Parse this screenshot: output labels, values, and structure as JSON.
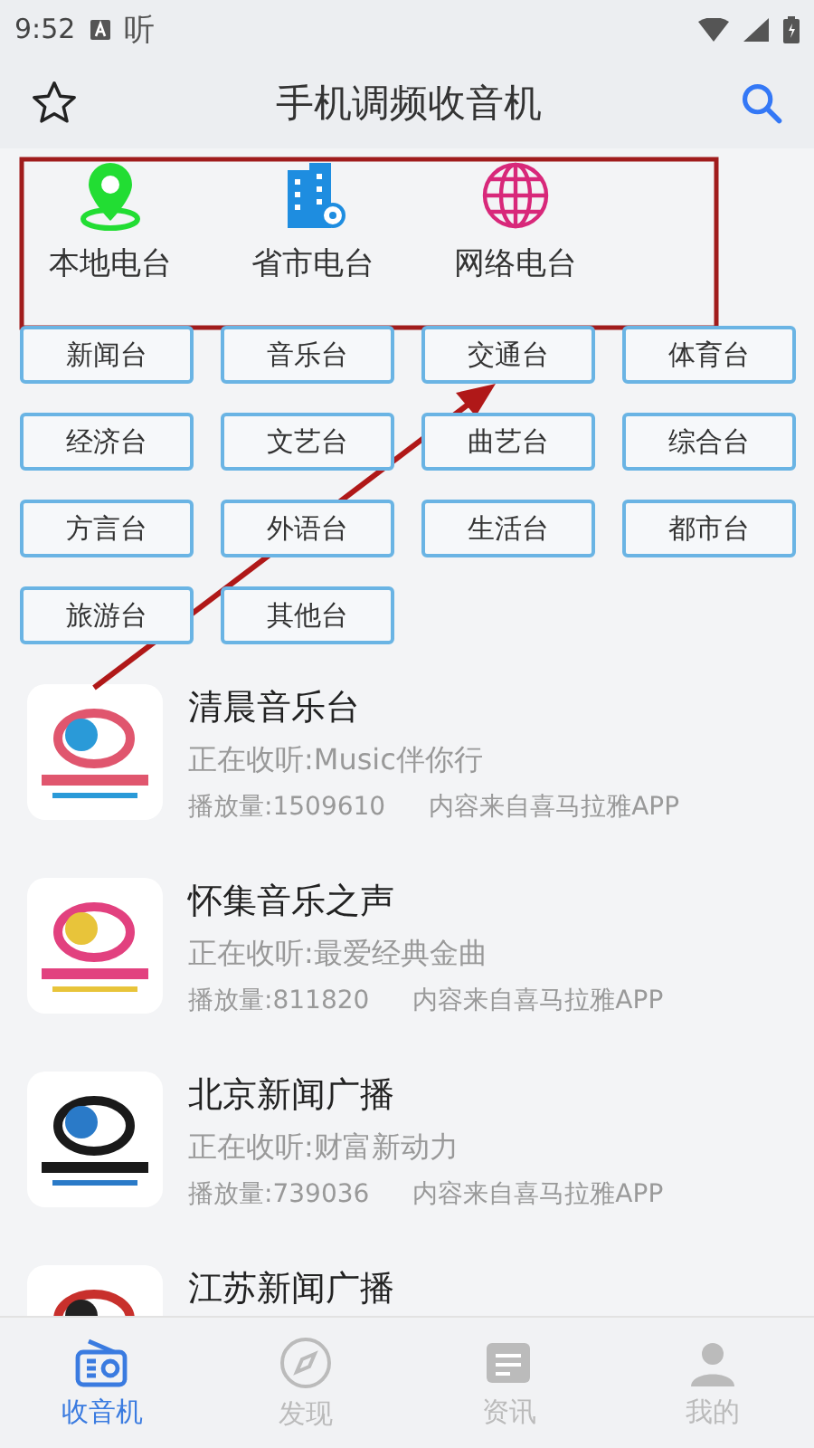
{
  "status_bar": {
    "time": "9:52",
    "app_glyph": "听"
  },
  "header": {
    "title": "手机调频收音机"
  },
  "categories": [
    {
      "label": "本地电台",
      "kind": "pin"
    },
    {
      "label": "省市电台",
      "kind": "building"
    },
    {
      "label": "网络电台",
      "kind": "globe"
    }
  ],
  "tags": [
    "新闻台",
    "音乐台",
    "交通台",
    "体育台",
    "经济台",
    "文艺台",
    "曲艺台",
    "综合台",
    "方言台",
    "外语台",
    "生活台",
    "都市台",
    "旅游台",
    "其他台"
  ],
  "stations": [
    {
      "name": "清晨音乐台",
      "now_playing": "正在收听:Music伴你行",
      "plays": "播放量:1509610",
      "source": "内容来自喜马拉雅APP"
    },
    {
      "name": "怀集音乐之声",
      "now_playing": "正在收听:最爱经典金曲",
      "plays": "播放量:811820",
      "source": "内容来自喜马拉雅APP"
    },
    {
      "name": "北京新闻广播",
      "now_playing": "正在收听:财富新动力",
      "plays": "播放量:739036",
      "source": "内容来自喜马拉雅APP"
    },
    {
      "name": "江苏新闻广播"
    }
  ],
  "tabbar": [
    {
      "label": "收音机",
      "kind": "radio",
      "selected": true
    },
    {
      "label": "发现",
      "kind": "compass",
      "selected": false
    },
    {
      "label": "资讯",
      "kind": "news",
      "selected": false
    },
    {
      "label": "我的",
      "kind": "user",
      "selected": false
    }
  ]
}
